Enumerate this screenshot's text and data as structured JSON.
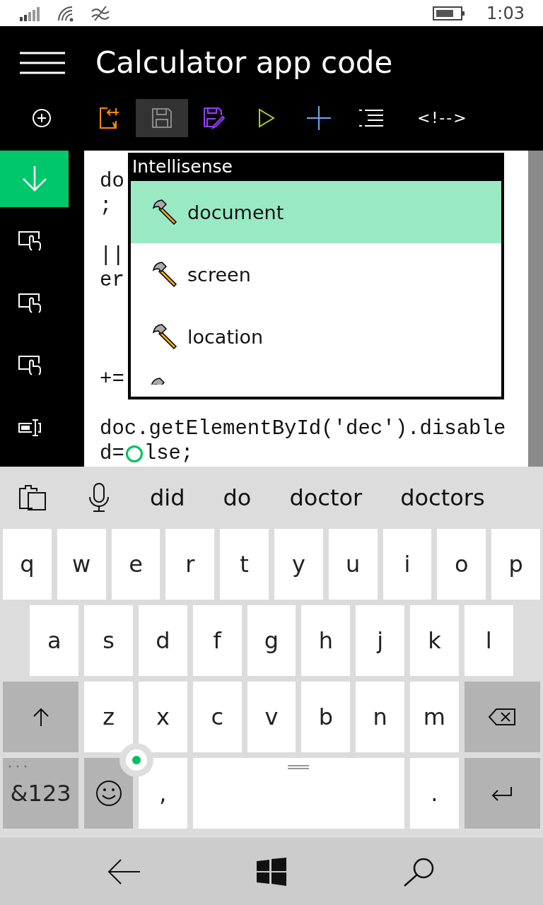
{
  "status_bar": {
    "time": "1:03"
  },
  "header": {
    "title": "Calculator app code"
  },
  "toolbar": [
    {
      "kind": "export",
      "selected": false
    },
    {
      "kind": "save",
      "selected": true
    },
    {
      "kind": "save-as",
      "selected": false
    },
    {
      "kind": "run",
      "selected": false
    },
    {
      "kind": "add",
      "selected": false
    },
    {
      "kind": "indent",
      "selected": false
    },
    {
      "kind": "comment",
      "selected": false,
      "label": "<!-->"
    }
  ],
  "sidebar": {
    "items": [
      {
        "kind": "download",
        "selected": true
      },
      {
        "kind": "touch",
        "selected": false
      },
      {
        "kind": "touch",
        "selected": false
      },
      {
        "kind": "touch",
        "selected": false
      },
      {
        "kind": "textbox",
        "selected": false
      }
    ]
  },
  "editor": {
    "lines": [
      "do",
      ";",
      "||",
      "er",
      "+=",
      "doc.getElementById('dec').disable"
    ],
    "cursor_line": {
      "before": "d=",
      "after": "lse;"
    }
  },
  "intellisense": {
    "title": "Intellisense",
    "items": [
      {
        "label": "document",
        "selected": true
      },
      {
        "label": "screen",
        "selected": false
      },
      {
        "label": "location",
        "selected": false
      }
    ]
  },
  "keyboard": {
    "suggestions": [
      "did",
      "do",
      "doctor",
      "doctors"
    ],
    "rows": [
      {
        "keys": [
          {
            "kind": "letter",
            "label": "q"
          },
          {
            "kind": "letter",
            "label": "w"
          },
          {
            "kind": "letter",
            "label": "e"
          },
          {
            "kind": "letter",
            "label": "r"
          },
          {
            "kind": "letter",
            "label": "t"
          },
          {
            "kind": "letter",
            "label": "y"
          },
          {
            "kind": "letter",
            "label": "u"
          },
          {
            "kind": "letter",
            "label": "i"
          },
          {
            "kind": "letter",
            "label": "o"
          },
          {
            "kind": "letter",
            "label": "p"
          }
        ]
      },
      {
        "keys": [
          {
            "kind": "letter",
            "label": "a"
          },
          {
            "kind": "letter",
            "label": "s"
          },
          {
            "kind": "letter",
            "label": "d"
          },
          {
            "kind": "letter",
            "label": "f"
          },
          {
            "kind": "letter",
            "label": "g"
          },
          {
            "kind": "letter",
            "label": "h"
          },
          {
            "kind": "letter",
            "label": "j"
          },
          {
            "kind": "letter",
            "label": "k"
          },
          {
            "kind": "letter",
            "label": "l"
          }
        ]
      },
      {
        "keys": [
          {
            "kind": "shift"
          },
          {
            "kind": "letter",
            "label": "z"
          },
          {
            "kind": "letter",
            "label": "x"
          },
          {
            "kind": "letter",
            "label": "c"
          },
          {
            "kind": "letter",
            "label": "v"
          },
          {
            "kind": "letter",
            "label": "b"
          },
          {
            "kind": "letter",
            "label": "n"
          },
          {
            "kind": "letter",
            "label": "m"
          },
          {
            "kind": "backspace"
          }
        ]
      },
      {
        "keys": [
          {
            "kind": "symbols",
            "label": "&123"
          },
          {
            "kind": "emoji"
          },
          {
            "kind": "punctuation",
            "label": ","
          },
          {
            "kind": "space"
          },
          {
            "kind": "punctuation",
            "label": "."
          },
          {
            "kind": "enter"
          }
        ]
      }
    ]
  }
}
